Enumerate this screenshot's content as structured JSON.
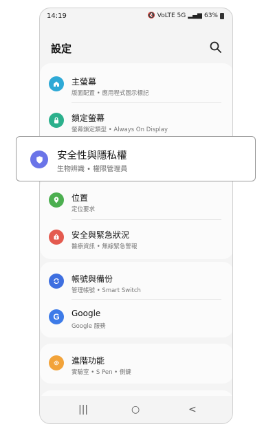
{
  "status_bar": {
    "time": "14:19",
    "indicators": "VoLTE 5G",
    "battery": "63%"
  },
  "header": {
    "title": "設定",
    "search_icon": "search-icon"
  },
  "items": {
    "home_screen": {
      "title": "主螢幕",
      "subtitle": "版面配置 • 應用程式圖示標記",
      "icon": "home-icon",
      "color": "#2ea9d6"
    },
    "lock_screen": {
      "title": "鎖定螢幕",
      "subtitle": "螢幕鎖定類型 • Always On Display",
      "icon": "lock-icon",
      "color": "#2bb08c"
    },
    "security": {
      "title": "安全性與隱私權",
      "subtitle": "生物辨識 • 權限管理員",
      "icon": "shield-icon",
      "color": "#6a74e8"
    },
    "location": {
      "title": "位置",
      "subtitle": "定位要求",
      "icon": "location-icon",
      "color": "#4caf50"
    },
    "safety": {
      "title": "安全與緊急狀況",
      "subtitle": "醫療資訊 • 無線緊急警報",
      "icon": "alert-icon",
      "color": "#e45a4f"
    },
    "accounts": {
      "title": "帳號與備份",
      "subtitle": "管理帳號 • Smart Switch",
      "icon": "sync-icon",
      "color": "#3e6fe0"
    },
    "google": {
      "title": "Google",
      "subtitle": "Google 服務",
      "icon": "google-icon",
      "color": "#3d7be8"
    },
    "advanced": {
      "title": "進階功能",
      "subtitle": "實驗室 • S Pen • 側鍵",
      "icon": "gear-icon",
      "color": "#f2a33a"
    }
  },
  "nav": {
    "recents": "|||",
    "home": "○",
    "back": "<"
  }
}
